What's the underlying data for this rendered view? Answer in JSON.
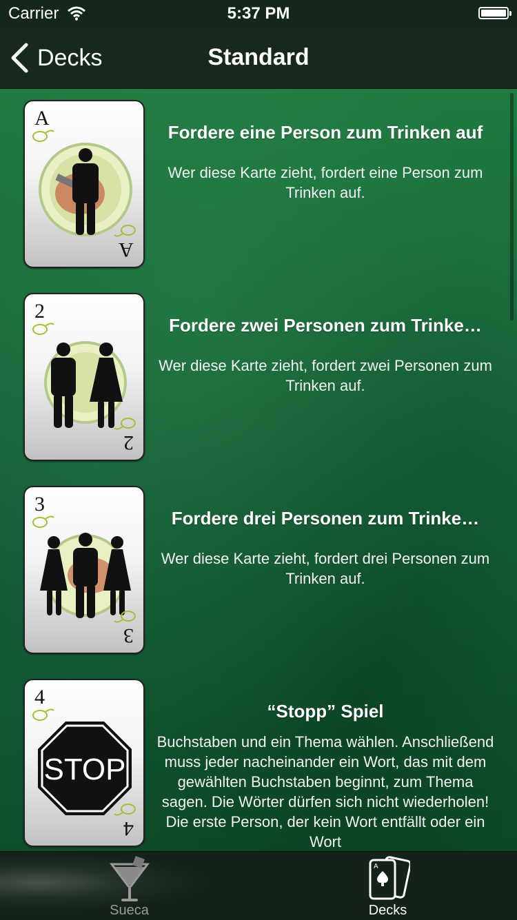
{
  "status_bar": {
    "carrier": "Carrier",
    "time": "5:37 PM"
  },
  "nav": {
    "back_label": "Decks",
    "title": "Standard"
  },
  "cards": [
    {
      "rank": "A",
      "icon": "one-person-icon",
      "title": "Fordere eine Person zum Trinken auf",
      "description": "Wer diese Karte zieht, fordert eine Person zum Trinken auf."
    },
    {
      "rank": "2",
      "icon": "two-persons-icon",
      "title": "Fordere zwei Personen zum Trinke…",
      "description": "Wer diese Karte zieht, fordert zwei Personen zum Trinken auf."
    },
    {
      "rank": "3",
      "icon": "three-persons-icon",
      "title": "Fordere drei Personen zum Trinke…",
      "description": "Wer diese Karte zieht, fordert drei Personen zum Trinken auf."
    },
    {
      "rank": "4",
      "icon": "stop-sign-icon",
      "stop_text": "STOP",
      "title": "“Stopp” Spiel",
      "description": "Buchstaben und ein Thema wählen. Anschließend muss jeder nacheinander ein Wort, das mit dem gewählten Buchstaben beginnt, zum Thema sagen. Die Wörter dürfen sich nicht wiederholen! Die erste Person, der kein Wort entfällt oder ein Wort"
    }
  ],
  "tabs": [
    {
      "label": "Sueca",
      "icon": "cocktail-glass-icon",
      "selected": false
    },
    {
      "label": "Decks",
      "icon": "playing-cards-icon",
      "selected": true
    }
  ],
  "colors": {
    "felt": "#1a5e34",
    "bar": "#17281c",
    "text": "#ffffff",
    "tab_inactive": "#9a9a9a"
  }
}
